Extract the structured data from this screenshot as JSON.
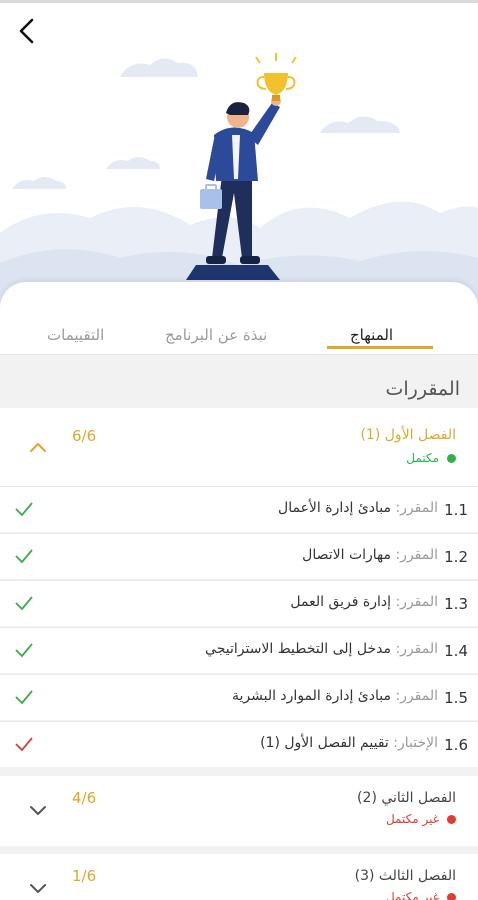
{
  "tabs": [
    {
      "label": "المنهاج",
      "active": true
    },
    {
      "label": "نبذة عن البرنامج",
      "active": false
    },
    {
      "label": "التقييمات",
      "active": false
    }
  ],
  "section_title": "المقررات",
  "semesters": [
    {
      "title": "الفصل الأول (1)",
      "progress": "6/6",
      "status": "مكتمل",
      "status_color": "#2bb34a",
      "expanded": true
    },
    {
      "title": "الفصل الثاني (2)",
      "progress": "4/6",
      "status": "غير مكتمل",
      "status_color": "#e53935",
      "expanded": false
    },
    {
      "title": "الفصل الثالث (3)",
      "progress": "1/6",
      "status": "غير مكتمل",
      "status_color": "#e53935",
      "expanded": false
    }
  ],
  "courses": [
    {
      "num": "1.1",
      "prefix": "المقرر:",
      "name": "مبادئ إدارة الأعمال",
      "done": true
    },
    {
      "num": "1.2",
      "prefix": "المقرر:",
      "name": "مهارات الاتصال",
      "done": true
    },
    {
      "num": "1.3",
      "prefix": "المقرر:",
      "name": "إدارة فريق العمل",
      "done": true
    },
    {
      "num": "1.4",
      "prefix": "المقرر:",
      "name": "مدخل إلى التخطيط الاستراتيجي",
      "done": true
    },
    {
      "num": "1.5",
      "prefix": "المقرر:",
      "name": "مبادئ إدارة الموارد البشرية",
      "done": true
    },
    {
      "num": "1.6",
      "prefix": "الإختبار:",
      "name": "تقييم الفصل الأول (1)",
      "done": false
    }
  ],
  "colors": {
    "accent": "#e2a62b",
    "check_green": "#3daa4f",
    "check_red": "#d9423b"
  },
  "icons": {
    "back": "chevron-left-icon",
    "expand": "chevron-up-icon",
    "collapse": "chevron-down-icon",
    "done": "check-icon"
  }
}
